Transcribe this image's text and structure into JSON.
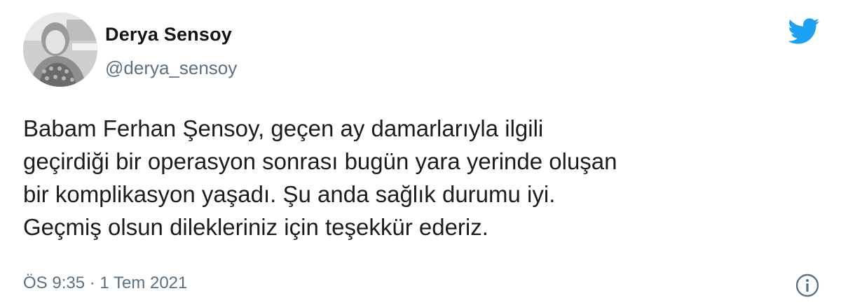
{
  "user": {
    "display_name": "Derya Sensoy",
    "handle": "@derya_sensoy",
    "avatar": "profile-photo"
  },
  "brand": {
    "logo_icon": "twitter-bird-icon",
    "accent_color": "#1da1f2"
  },
  "tweet": {
    "lines": [
      "Babam Ferhan Şensoy, geçen ay damarlarıyla ilgili",
      "geçirdiği bir operasyon sonrası bugün yara yerinde oluşan",
      "bir komplikasyon yaşadı. Şu anda sağlık durumu iyi.",
      "Geçmiş olsun dilekleriniz için teşekkür ederiz."
    ],
    "timestamp": "ÖS 9:35 · 1 Tem 2021"
  },
  "actions": {
    "info_icon": "info-icon"
  }
}
